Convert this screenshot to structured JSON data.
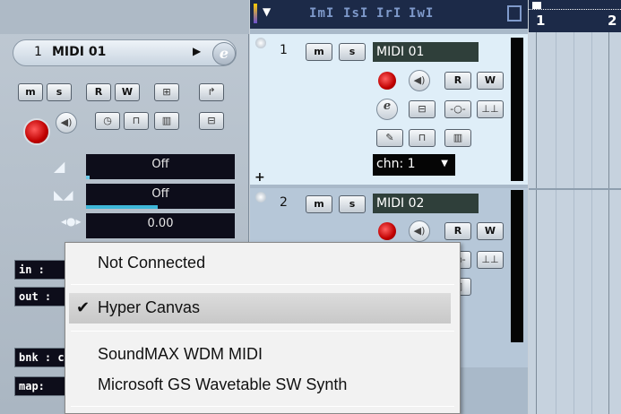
{
  "inspector": {
    "track_number": "1",
    "track_name": "MIDI 01",
    "buttons_row1": [
      "m",
      "s",
      "R",
      "W"
    ],
    "volume": "Off",
    "pan": "Off",
    "delay": "0.00",
    "in_label": "in :",
    "out_label": "out :",
    "bank_label": "bnk : c",
    "map_label": "map:"
  },
  "tracklist_header": {
    "labels": [
      "m",
      "s",
      "r",
      "w"
    ]
  },
  "tracks": [
    {
      "number": "1",
      "name": "MIDI 01",
      "m": "m",
      "s": "s",
      "r": "R",
      "w": "W",
      "channel": "chn: 1"
    },
    {
      "number": "2",
      "name": "MIDI 02",
      "m": "m",
      "s": "s",
      "r": "R",
      "w": "W"
    }
  ],
  "ruler": {
    "marks": [
      "1",
      "2"
    ]
  },
  "popup_menu": {
    "items": [
      {
        "label": "Not Connected",
        "checked": false
      },
      {
        "label": "Hyper Canvas",
        "checked": true
      },
      {
        "label": "SoundMAX WDM MIDI",
        "checked": false
      },
      {
        "label": "Microsoft GS Wavetable SW Synth",
        "checked": false
      }
    ],
    "check_glyph": "✔"
  },
  "colors": {
    "record_red": "#cc0000",
    "header_navy": "#1c2a48",
    "track1_bg": "#dfeef8"
  }
}
